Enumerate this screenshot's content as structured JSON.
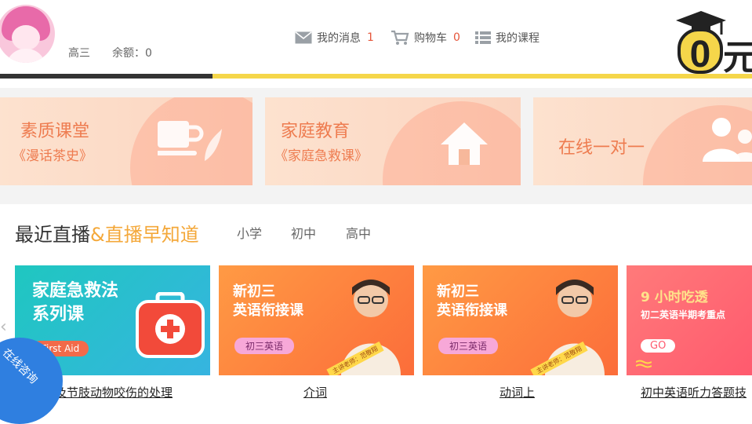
{
  "header": {
    "grade": "高三",
    "balance": "余额：0",
    "nav": [
      {
        "icon": "mail-icon",
        "label": "我的消息",
        "count": "1"
      },
      {
        "icon": "cart-icon",
        "label": "购物车",
        "count": "0"
      },
      {
        "icon": "list-icon",
        "label": "我的课程"
      }
    ],
    "logo_text": "0元"
  },
  "progress": {
    "fraction": 0.283
  },
  "categories": [
    {
      "title": "素质课堂",
      "subtitle": "《漫话茶史》",
      "icon": "tea-cup-icon"
    },
    {
      "title": "家庭教育",
      "subtitle": "《家庭急救课》",
      "icon": "house-icon"
    },
    {
      "title": "在线一对一",
      "subtitle": "",
      "icon": "people-icon"
    }
  ],
  "section": {
    "title_main": "最近直播",
    "title_accent": "&直播早知道",
    "tabs": [
      "小学",
      "初中",
      "高中"
    ]
  },
  "courses": [
    {
      "banner_title_1": "家庭急救法",
      "banner_title_2": "系列课",
      "tag": "First Aid",
      "caption": "及节肢动物咬伤的处理"
    },
    {
      "banner_title_1": "新初三",
      "banner_title_2": "英语衔接课",
      "tag": "初三英语",
      "teacher": "主讲老师：范敬翔",
      "caption": "介词"
    },
    {
      "banner_title_1": "新初三",
      "banner_title_2": "英语衔接课",
      "tag": "初三英语",
      "teacher": "主讲老师：范敬翔",
      "caption": "动词上"
    },
    {
      "banner_title_1": "9 小时吃透",
      "banner_title_2": "初二英语半期考重点",
      "tag": "GO",
      "caption": "初中英语听力答题技"
    }
  ],
  "chat": {
    "label": "在线咨询"
  },
  "colors": {
    "accent": "#f4a83a",
    "brand_orange": "#ee7c50",
    "progress_yellow": "#f5d64a",
    "chat_blue": "#2f7fe0"
  }
}
